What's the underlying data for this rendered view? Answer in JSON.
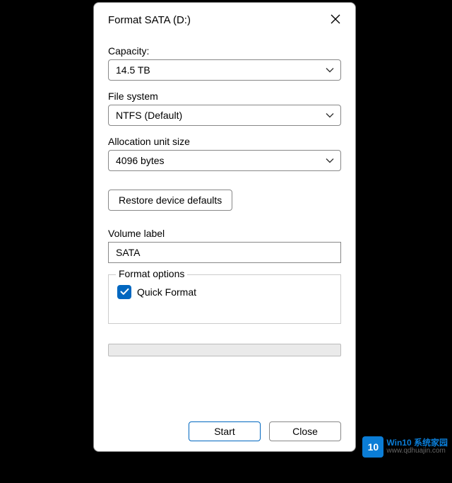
{
  "dialog": {
    "title": "Format SATA (D:)",
    "capacity": {
      "label": "Capacity:",
      "value": "14.5 TB"
    },
    "filesystem": {
      "label": "File system",
      "value": "NTFS (Default)"
    },
    "allocation": {
      "label": "Allocation unit size",
      "value": "4096 bytes"
    },
    "restore_button": "Restore device defaults",
    "volume": {
      "label": "Volume label",
      "value": "SATA"
    },
    "format_options": {
      "legend": "Format options",
      "quick_format": {
        "label": "Quick Format",
        "checked": true
      }
    },
    "buttons": {
      "start": "Start",
      "close": "Close"
    }
  },
  "watermark": {
    "badge": "10",
    "line1": "Win10 系统家园",
    "line2": "www.qdhuajin.com"
  }
}
